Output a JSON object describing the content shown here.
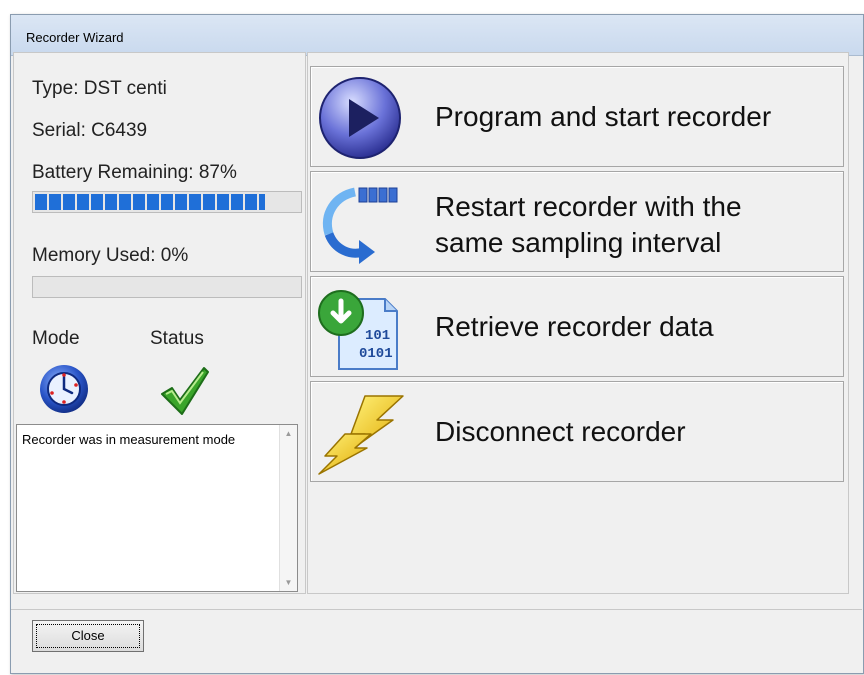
{
  "window": {
    "title": "Recorder Wizard"
  },
  "info": {
    "type": "Type: DST centi",
    "serial": "Serial: C6439",
    "battery_label": "Battery Remaining: 87%",
    "battery_level": 0.87,
    "memory_label": "Memory Used: 0%",
    "memory_level": 0,
    "mode_label": "Mode",
    "status_label": "Status"
  },
  "log": {
    "text": "Recorder was in measurement mode"
  },
  "actions": [
    {
      "label": "Program and start recorder",
      "icon": "play-icon"
    },
    {
      "label_line1": "Restart recorder with the",
      "label_line2": "same sampling interval",
      "icon": "restart-icon"
    },
    {
      "label": "Retrieve recorder data",
      "icon": "download-data-icon"
    },
    {
      "label": "Disconnect recorder",
      "icon": "lightning-disconnect-icon"
    }
  ],
  "footer": {
    "close_label": "Close"
  },
  "colors": {
    "progress": "#1f6fd8",
    "titlebar": "#c9d9ee",
    "check": "#3aa52a"
  }
}
